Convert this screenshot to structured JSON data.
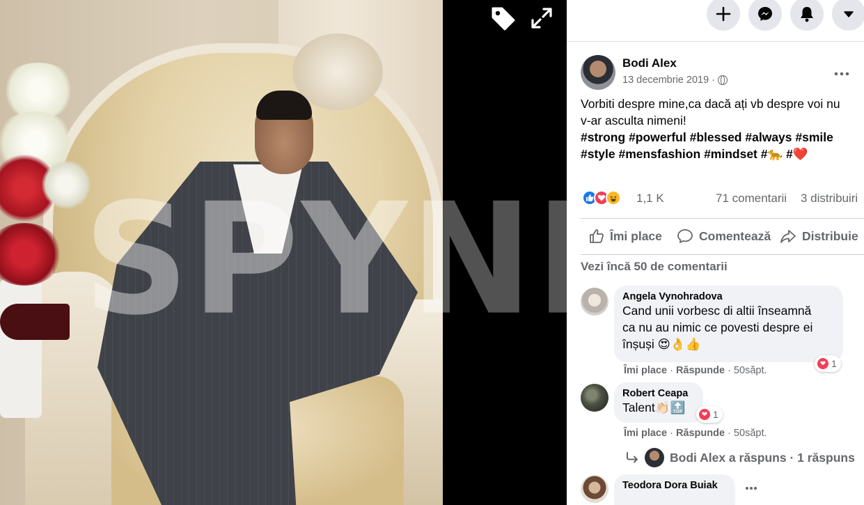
{
  "viewer": {
    "watermark": "SPYNE",
    "tag_icon": "tag-icon",
    "expand_icon": "expand-icon"
  },
  "topbar": {
    "buttons": [
      {
        "icon": "plus-icon"
      },
      {
        "icon": "messenger-icon"
      },
      {
        "icon": "bell-icon"
      },
      {
        "icon": "chevron-down-icon"
      }
    ]
  },
  "post": {
    "author": "Bodi Alex",
    "date": "13 decembrie 2019 ·",
    "privacy_icon": "globe-icon",
    "text_line1": "Vorbiti despre mine,ca dacă ați vb despre voi nu",
    "text_line2": "v-ar asculta nimeni!",
    "hashtags_line1": [
      "#strong",
      "#powerful",
      "#blessed",
      "#always",
      "#smile"
    ],
    "hashtags_line2": [
      "#style",
      "#mensfashion",
      "#mindset",
      "#🐆",
      "#❤️"
    ],
    "reactions_count": "1,1 K",
    "comments_count": "71 comentarii",
    "shares_count": "3 distribuiri",
    "actions": {
      "like": "Îmi place",
      "comment": "Comentează",
      "share": "Distribuie"
    },
    "see_more_comments": "Vezi încă 50 de comentarii"
  },
  "comments": [
    {
      "name": "Angela Vynohradova",
      "text_lines": [
        "Cand unii vorbesc di altii înseamnă",
        "ca nu au nimic ce povesti despre ei",
        "înșuși 😍👌👍"
      ],
      "like": "Îmi place",
      "reply": "Răspunde",
      "time": "· 50săpt.",
      "reactions": "1"
    },
    {
      "name": "Robert Ceapa",
      "text_lines": [
        "Talent👏🏻🔝"
      ],
      "like": "Îmi place",
      "reply": "Răspunde",
      "time": "· 50săpt.",
      "reactions": "1"
    },
    {
      "name": "Teodora Dora Buiak"
    }
  ],
  "reply_summary": "Bodi Alex a răspuns · 1 răspuns",
  "colors": {
    "accent": "#1877f2",
    "love": "#f33e58",
    "secondary_text": "#65676b",
    "bubble": "#f0f2f5"
  }
}
